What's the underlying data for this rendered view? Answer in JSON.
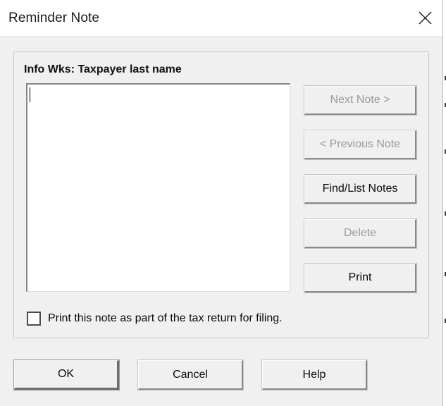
{
  "window": {
    "title": "Reminder Note",
    "close_icon": "close-x-icon"
  },
  "group": {
    "label": "Info Wks: Taxpayer last name"
  },
  "note": {
    "value": "",
    "placeholder": ""
  },
  "side_buttons": [
    {
      "label": "Next Note >",
      "enabled": false
    },
    {
      "label": "< Previous Note",
      "enabled": false
    },
    {
      "label": "Find/List Notes",
      "enabled": true
    },
    {
      "label": "Delete",
      "enabled": false
    },
    {
      "label": "Print",
      "enabled": true
    }
  ],
  "checkbox": {
    "label": "Print this note as part of the tax return for filing.",
    "checked": false
  },
  "bottom_buttons": [
    {
      "label": "OK",
      "default": true
    },
    {
      "label": "Cancel",
      "default": false
    },
    {
      "label": "Help",
      "default": false
    }
  ],
  "colors": {
    "dialog_background": "#f0f0f0",
    "titlebar_background": "#ffffff",
    "title_text": "#1b1b1b",
    "text": "#0a0a0a",
    "disabled_text": "#9a9a9a",
    "field_background": "#ffffff",
    "group_border": "#c8c8c8"
  }
}
